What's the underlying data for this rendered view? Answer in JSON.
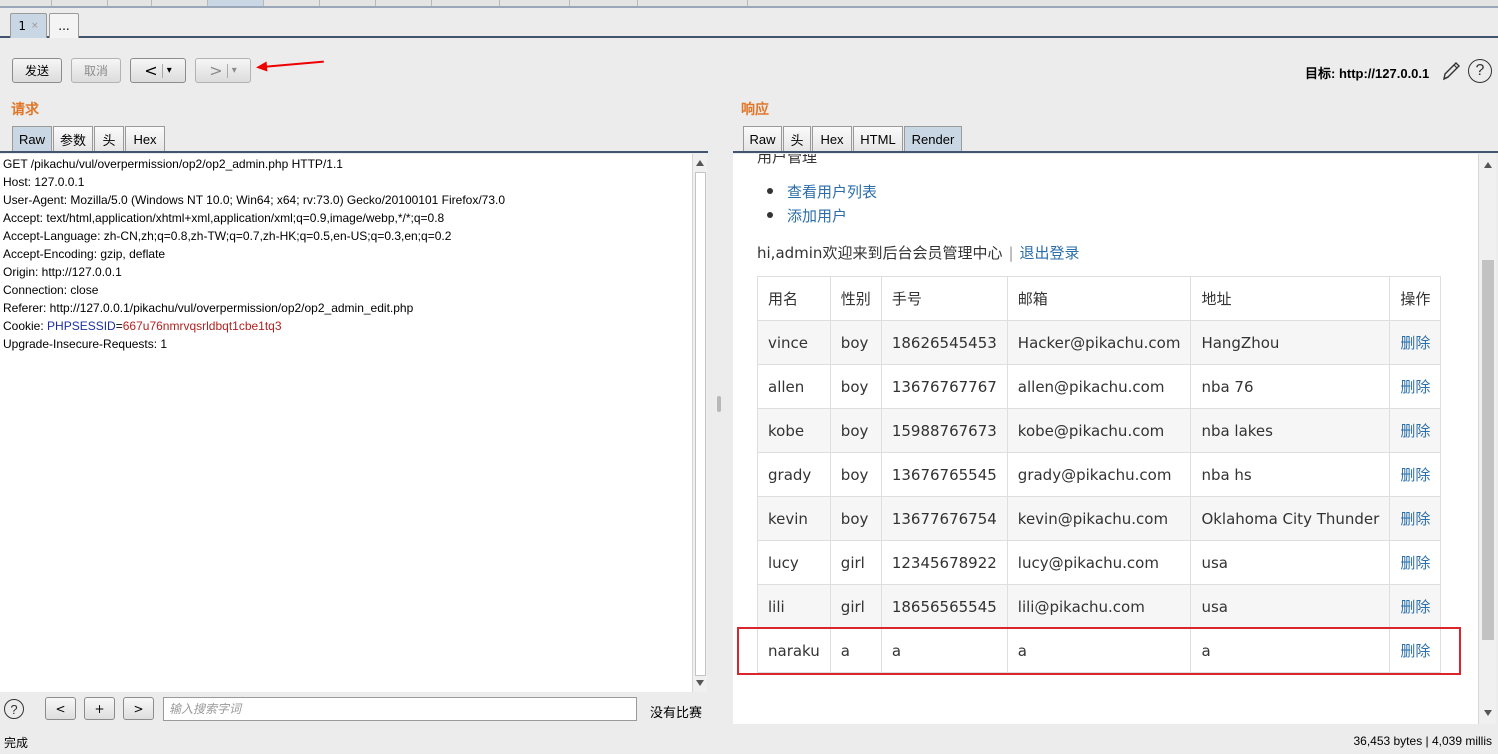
{
  "tabs": [
    {
      "label": "1",
      "close": "×"
    },
    {
      "label": "..."
    }
  ],
  "toolbar": {
    "send_label": "发送",
    "cancel_label": "取消",
    "back_label": "<",
    "forward_label": ">",
    "dropdown_glyph": "▾",
    "target_label": "目标: http://127.0.0.1",
    "help_glyph": "?"
  },
  "request": {
    "title": "请求",
    "tabs": [
      "Raw",
      "参数",
      "头",
      "Hex"
    ],
    "lines": [
      "GET /pikachu/vul/overpermission/op2/op2_admin.php HTTP/1.1",
      "Host: 127.0.0.1",
      "User-Agent: Mozilla/5.0 (Windows NT 10.0; Win64; x64; rv:73.0) Gecko/20100101 Firefox/73.0",
      "Accept: text/html,application/xhtml+xml,application/xml;q=0.9,image/webp,*/*;q=0.8",
      "Accept-Language: zh-CN,zh;q=0.8,zh-TW;q=0.7,zh-HK;q=0.5,en-US;q=0.3,en;q=0.2",
      "Accept-Encoding: gzip, deflate",
      "Origin: http://127.0.0.1",
      "Connection: close",
      "Referer: http://127.0.0.1/pikachu/vul/overpermission/op2/op2_admin_edit.php"
    ],
    "cookie_prefix": "Cookie: ",
    "cookie_name": "PHPSESSID",
    "cookie_eq": "=",
    "cookie_value": "667u76nmrvqsrldbqt1cbe1tq3",
    "last_line": "Upgrade-Insecure-Requests: 1"
  },
  "search": {
    "help_glyph": "?",
    "prev_label": "<",
    "add_label": "+",
    "next_label": ">",
    "placeholder": "输入搜索字词",
    "no_match": "没有比赛"
  },
  "response": {
    "title": "响应",
    "tabs": [
      "Raw",
      "头",
      "Hex",
      "HTML",
      "Render"
    ],
    "clipped_heading": "用户管理",
    "menu": [
      "查看用户列表",
      "添加用户"
    ],
    "welcome_text": "hi,admin欢迎来到后台会员管理中心",
    "welcome_sep": "|",
    "logout_label": "退出登录",
    "table": {
      "headers": [
        "用名",
        "性别",
        "手号",
        "邮箱",
        "地址",
        "操作"
      ],
      "rows": [
        [
          "vince",
          "boy",
          "18626545453",
          "Hacker@pikachu.com",
          "HangZhou",
          "删除"
        ],
        [
          "allen",
          "boy",
          "13676767767",
          "allen@pikachu.com",
          "nba 76",
          "删除"
        ],
        [
          "kobe",
          "boy",
          "15988767673",
          "kobe@pikachu.com",
          "nba lakes",
          "删除"
        ],
        [
          "grady",
          "boy",
          "13676765545",
          "grady@pikachu.com",
          "nba hs",
          "删除"
        ],
        [
          "kevin",
          "boy",
          "13677676754",
          "kevin@pikachu.com",
          "Oklahoma City Thunder",
          "删除"
        ],
        [
          "lucy",
          "girl",
          "12345678922",
          "lucy@pikachu.com",
          "usa",
          "删除"
        ],
        [
          "lili",
          "girl",
          "18656565545",
          "lili@pikachu.com",
          "usa",
          "删除"
        ],
        [
          "naraku",
          "a",
          "a",
          "a",
          "a",
          "删除"
        ]
      ]
    }
  },
  "status": {
    "left": "完成",
    "right": "36,453 bytes | 4,039 millis"
  },
  "colors": {
    "accent": "#e0772a",
    "link": "#2b6ea8",
    "highlight": "#d9262c"
  }
}
